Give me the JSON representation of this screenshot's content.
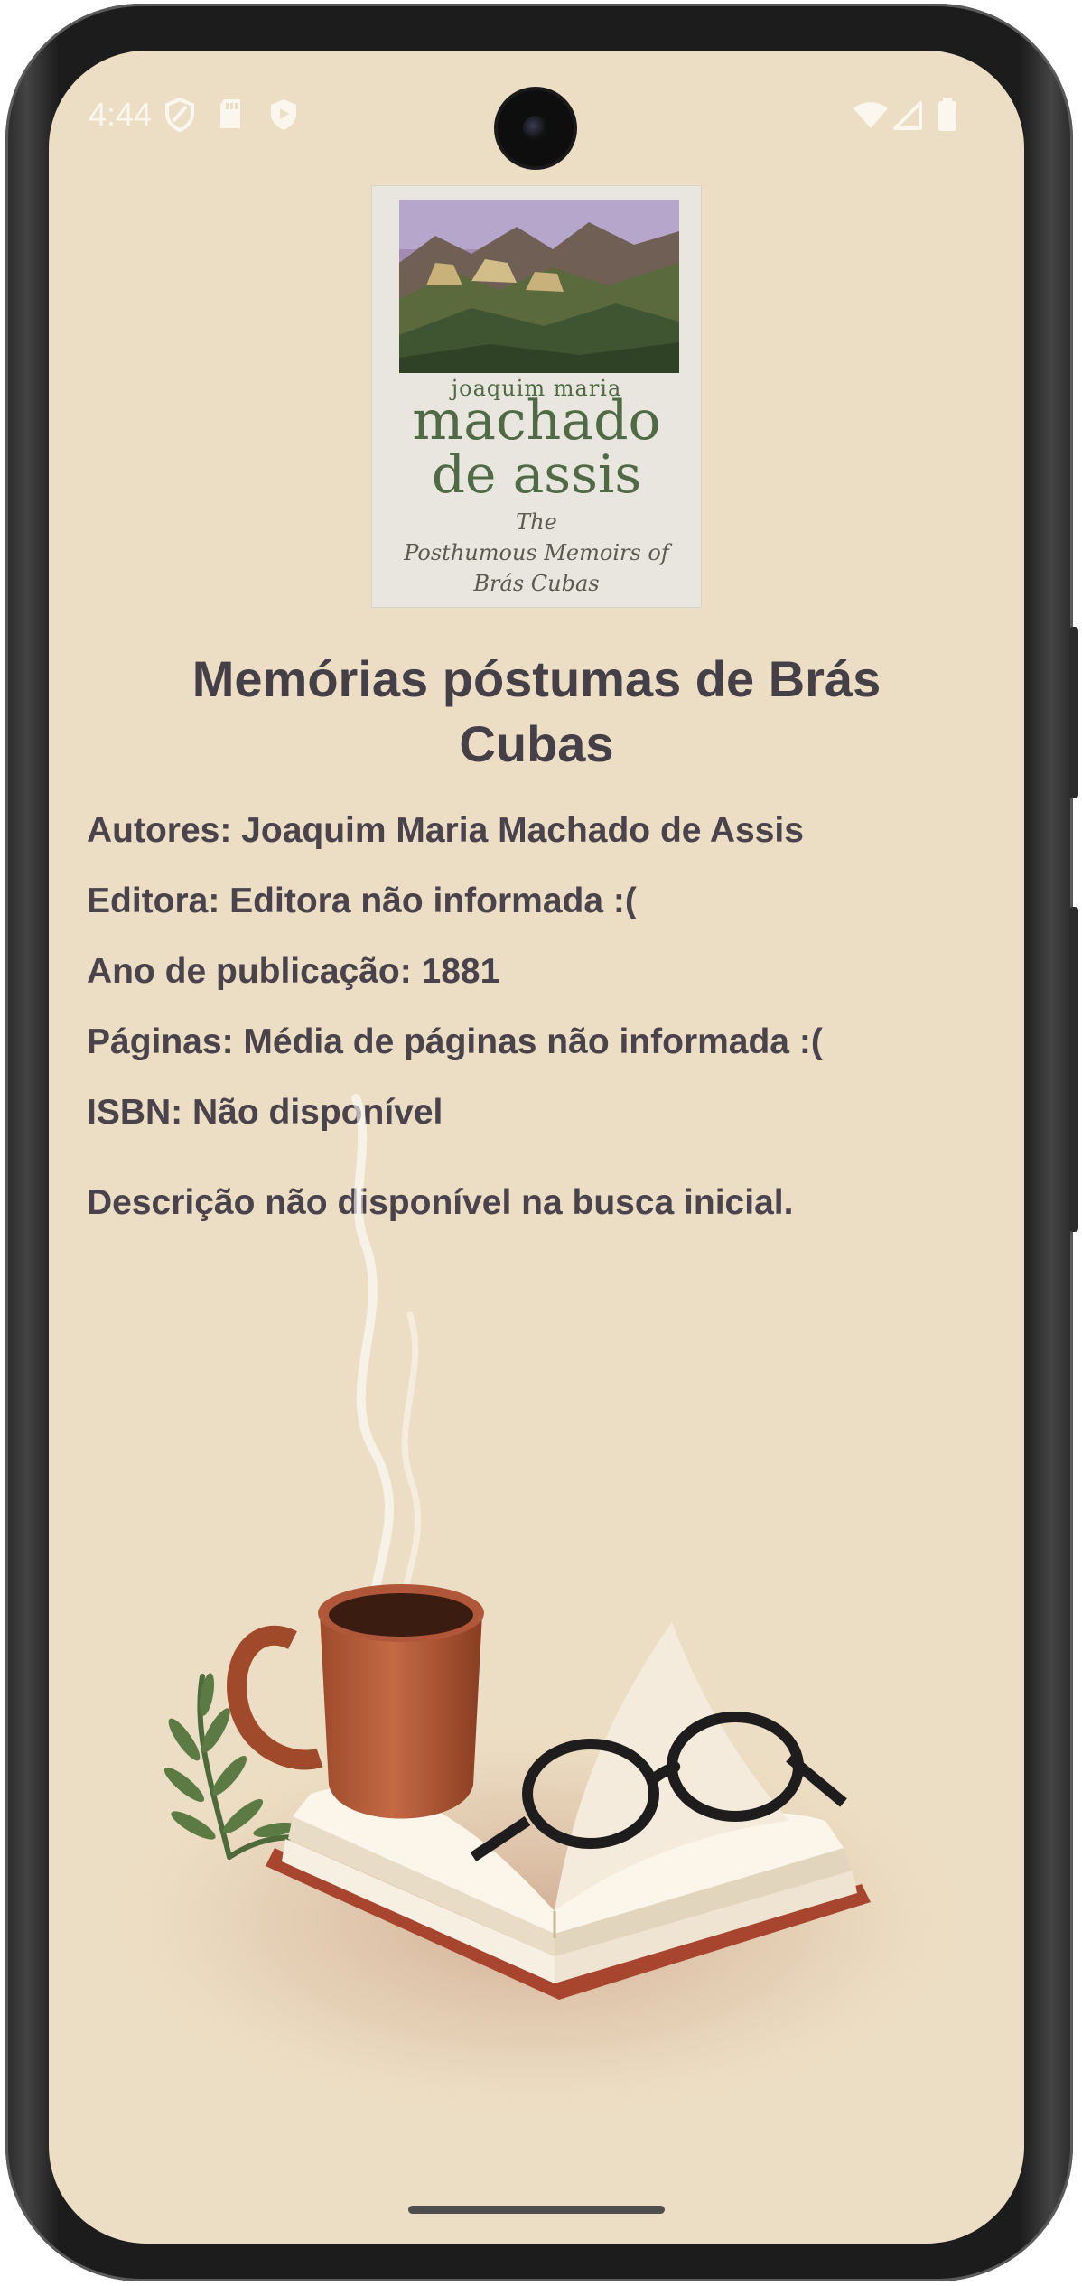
{
  "status_bar": {
    "time": "4:44",
    "left_icons": [
      "shield-icon",
      "sd-card-icon",
      "play-protect-icon"
    ],
    "right_icons": [
      "wifi-icon",
      "cell-signal-icon",
      "battery-icon"
    ]
  },
  "book": {
    "cover": {
      "author_small": "joaquim maria",
      "author_line1": "machado",
      "author_line2": "de assis",
      "subtitle_line1": "The",
      "subtitle_line2": "Posthumous Memoirs of",
      "subtitle_line3": "Brás Cubas"
    },
    "title": "Memórias póstumas de Brás Cubas",
    "authors": "Autores: Joaquim Maria Machado de Assis",
    "publisher": "Editora: Editora não informada :(",
    "year": "Ano de publicação: 1881",
    "pages": "Páginas: Média de páginas não informada :(",
    "isbn": "ISBN: Não disponível",
    "description": "Descrição não disponível na busca inicial."
  },
  "colors": {
    "background": "#ecdec4",
    "text": "#4a434c"
  }
}
